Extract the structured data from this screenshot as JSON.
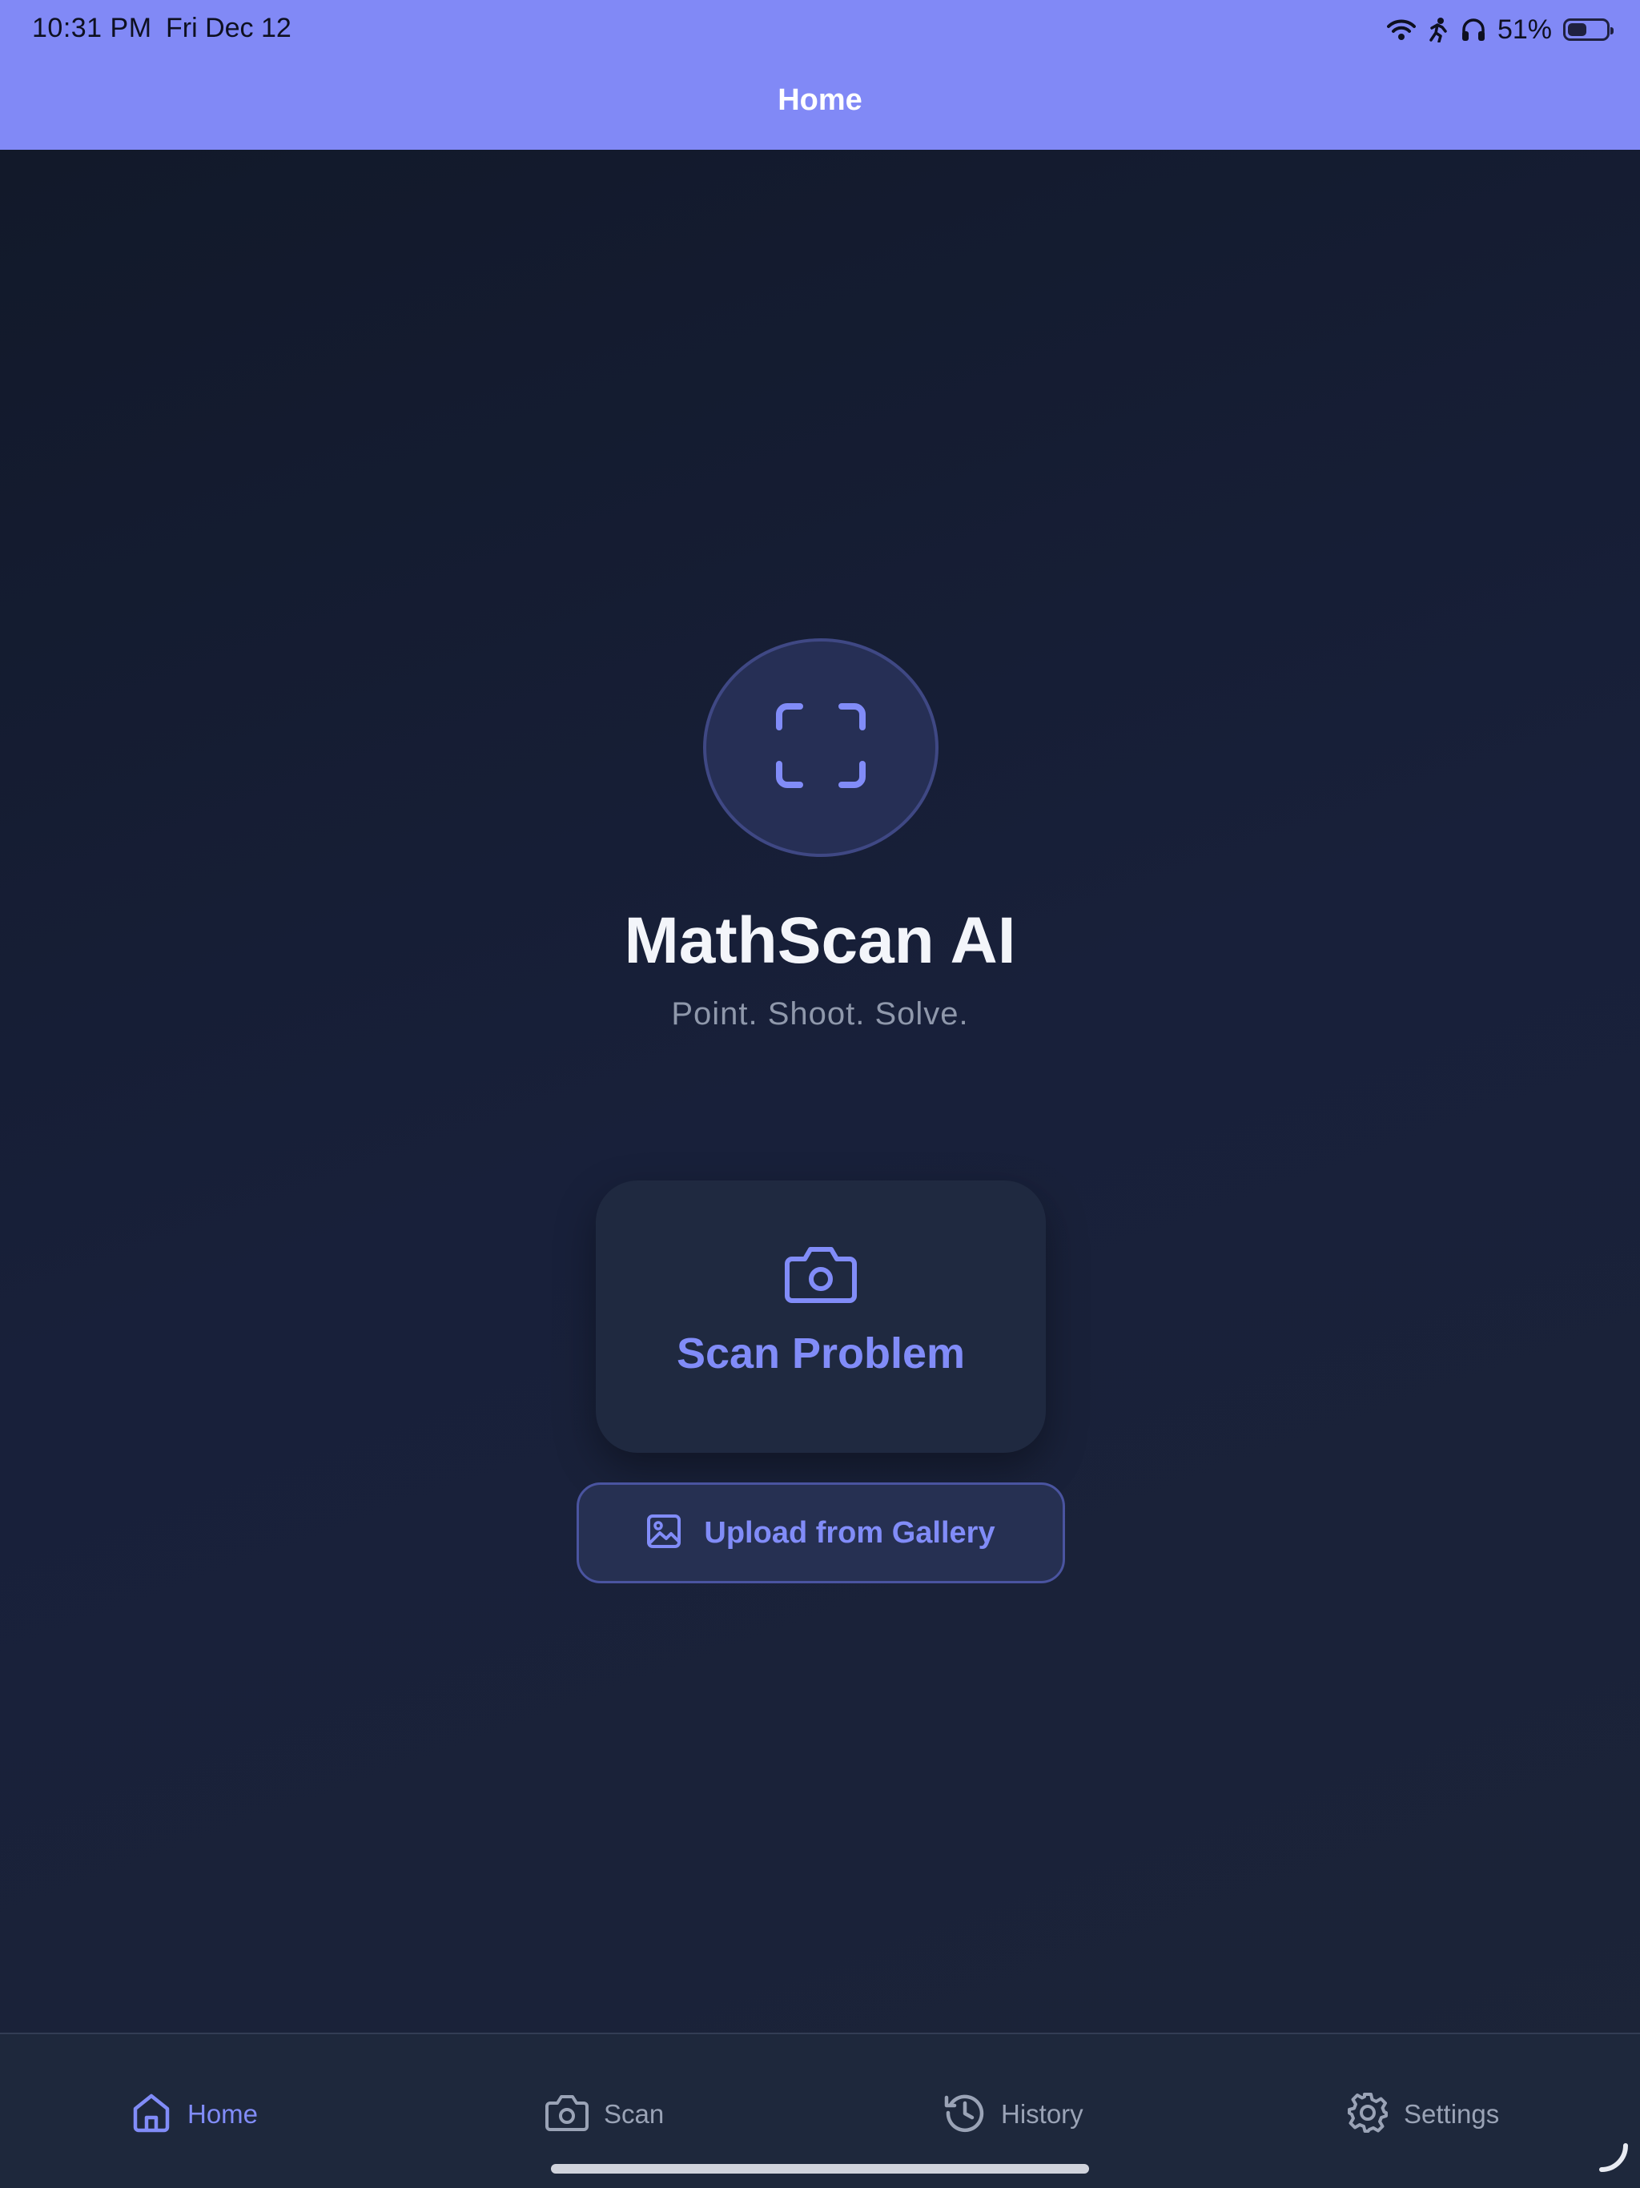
{
  "status_bar": {
    "time": "10:31 PM",
    "date": "Fri Dec 12",
    "battery_percent": "51%",
    "battery_level": 0.51,
    "icons": [
      "wifi-icon",
      "activity-icon",
      "headphones-icon",
      "battery-icon"
    ]
  },
  "header": {
    "title": "Home"
  },
  "main": {
    "logo_icon": "scan-frame-icon",
    "app_title": "MathScan AI",
    "tagline": "Point. Shoot. Solve.",
    "scan_button": {
      "icon": "camera-icon",
      "label": "Scan Problem"
    },
    "upload_button": {
      "icon": "image-icon",
      "label": "Upload from Gallery"
    }
  },
  "tabbar": {
    "active": "home",
    "tabs": [
      {
        "id": "home",
        "icon": "home-icon",
        "label": "Home"
      },
      {
        "id": "scan",
        "icon": "camera-icon",
        "label": "Scan"
      },
      {
        "id": "history",
        "icon": "history-icon",
        "label": "History"
      },
      {
        "id": "settings",
        "icon": "gear-icon",
        "label": "Settings"
      }
    ]
  },
  "colors": {
    "header_bg": "#8189f6",
    "accent": "#818cf8",
    "background": "#131b2e",
    "card_bg": "#1f2940",
    "muted_text": "#9aa3b6"
  }
}
